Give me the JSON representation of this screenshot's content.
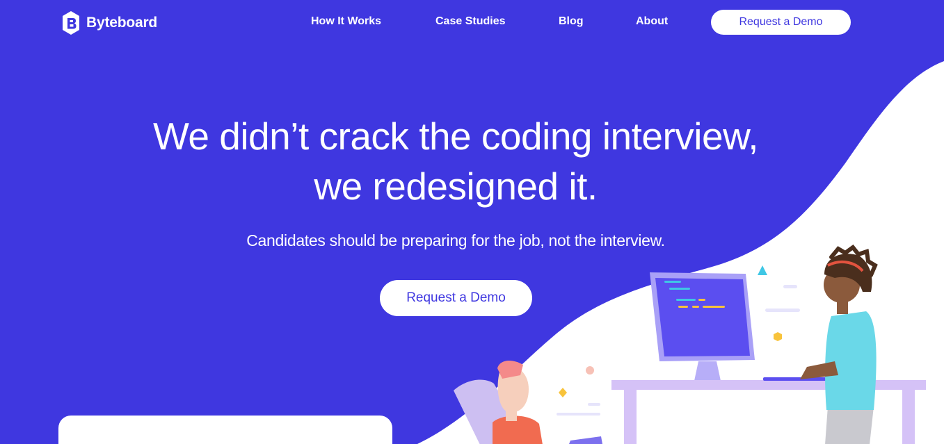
{
  "brand": {
    "name": "Byteboard"
  },
  "nav": {
    "items": [
      {
        "label": "How It Works"
      },
      {
        "label": "Case Studies"
      },
      {
        "label": "Blog"
      },
      {
        "label": "About"
      }
    ],
    "cta_label": "Request a Demo"
  },
  "hero": {
    "title_line1": "We didn’t crack the coding interview,",
    "title_line2": "we redesigned it.",
    "subtitle": "Candidates should be preparing for the job, not the interview.",
    "cta_label": "Request a Demo"
  },
  "colors": {
    "background": "#3f37e0",
    "accent": "#3f37e0",
    "white": "#ffffff",
    "desk": "#d5c2f7",
    "shirt": "#6ad8e8",
    "monitor": "#5b4ef0"
  },
  "icons": [
    "byteboard-logo-icon"
  ]
}
